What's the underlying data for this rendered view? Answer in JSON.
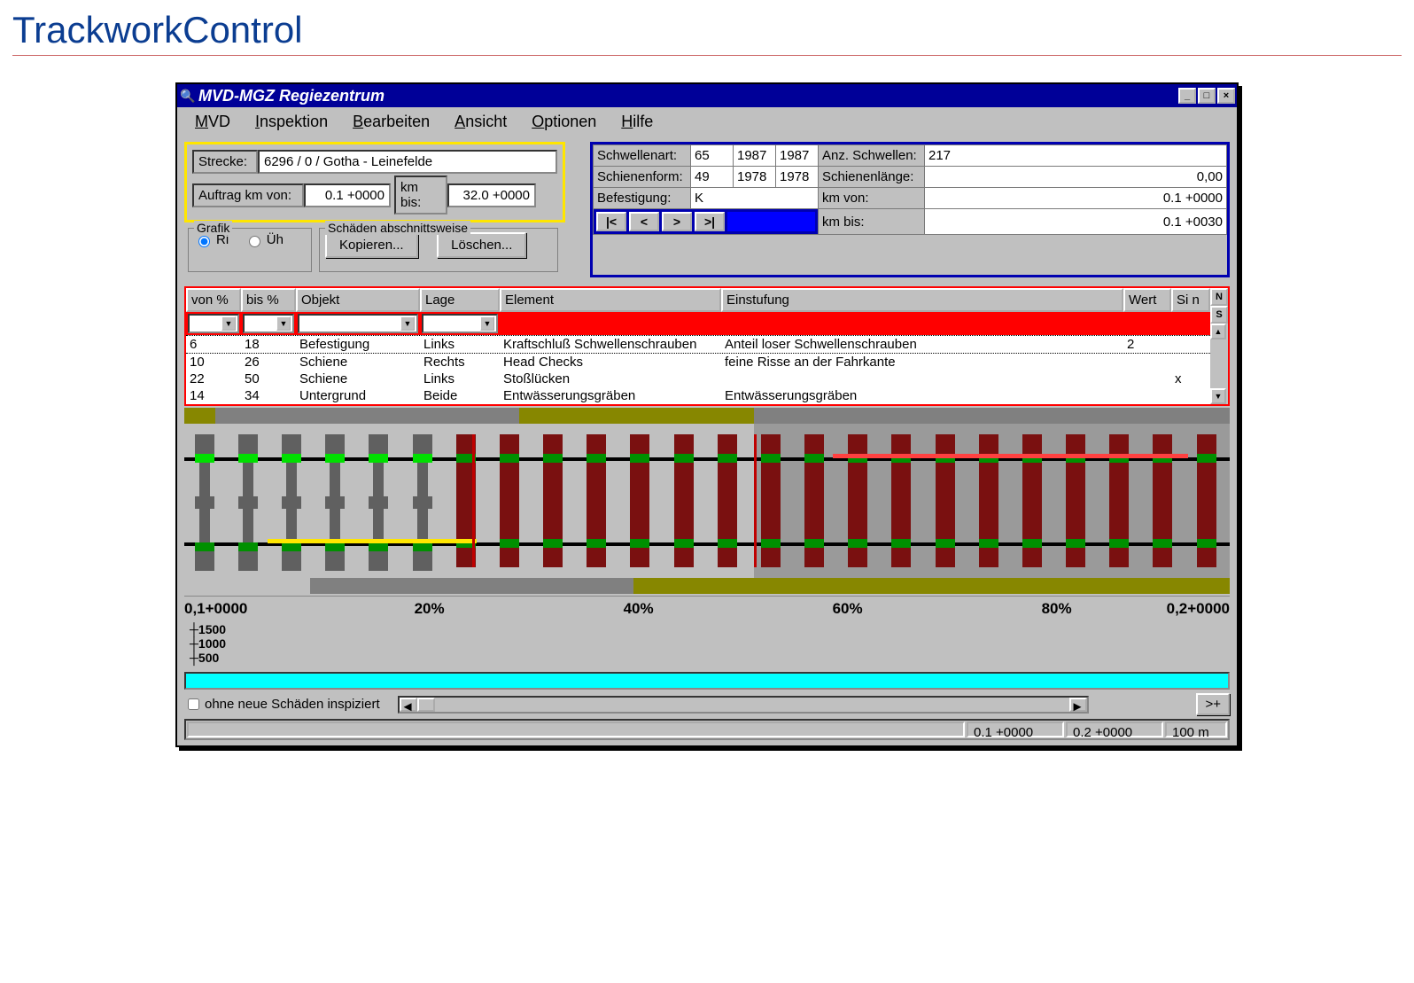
{
  "page_title": "TrackworkControl",
  "window": {
    "title": "MVD-MGZ Regiezentrum",
    "menu": [
      "MVD",
      "Inspektion",
      "Bearbeiten",
      "Ansicht",
      "Optionen",
      "Hilfe"
    ],
    "controls": {
      "min": "_",
      "max": "□",
      "close": "×"
    }
  },
  "left_panel": {
    "strecke_label": "Strecke:",
    "strecke_value": "6296 / 0 / Gotha - Leinefelde",
    "auftrag_label": "Auftrag  km von:",
    "km_von": "0.1 +0000",
    "km_bis_label": "km bis:",
    "km_bis": "32.0 +0000",
    "grafik_title": "Grafik",
    "radio_ri": "Ri",
    "radio_uh": "Üh",
    "schaden_title": "Schäden abschnittsweise",
    "btn_kopieren": "Kopieren...",
    "btn_loeschen": "Löschen..."
  },
  "right_panel": {
    "schwellenart_l": "Schwellenart:",
    "schwellenart_v": "65",
    "schw_y1": "1987",
    "schw_y2": "1987",
    "anz_schw_l": "Anz. Schwellen:",
    "anz_schw_v": "217",
    "schienenform_l": "Schienenform:",
    "schienenform_v": "49",
    "sf_y1": "1978",
    "sf_y2": "1978",
    "schienenlaenge_l": "Schienenlänge:",
    "schienenlaenge_v": "0,00",
    "befestigung_l": "Befestigung:",
    "befestigung_v": "K",
    "km_von_l": "km von:",
    "km_von_v": "0.1 +0000",
    "km_bis_l": "km bis:",
    "km_bis_v": "0.1 +0030",
    "nav": {
      "first": "|<",
      "prev": "<",
      "next": ">",
      "last": ">|"
    }
  },
  "table": {
    "headers": [
      "von %",
      "bis %",
      "Objekt",
      "Lage",
      "Element",
      "Einstufung",
      "Wert",
      "Si n"
    ],
    "side_n": "N",
    "side_s": "S",
    "rows": [
      {
        "von": "6",
        "bis": "18",
        "objekt": "Befestigung",
        "lage": "Links",
        "element": "Kraftschluß Schwellenschrauben",
        "einstufung": "Anteil loser Schwellenschrauben",
        "wert": "2",
        "sin": ""
      },
      {
        "von": "10",
        "bis": "26",
        "objekt": "Schiene",
        "lage": "Rechts",
        "element": "Head Checks",
        "einstufung": "feine Risse an der Fahrkante",
        "wert": "",
        "sin": ""
      },
      {
        "von": "22",
        "bis": "50",
        "objekt": "Schiene",
        "lage": "Links",
        "element": "Stoßlücken",
        "einstufung": "",
        "wert": "",
        "sin": "x"
      },
      {
        "von": "14",
        "bis": "34",
        "objekt": "Untergrund",
        "lage": "Beide",
        "element": "Entwässerungsgräben",
        "einstufung": "Entwässerungsgräben",
        "wert": "",
        "sin": ""
      }
    ]
  },
  "ruler": {
    "start": "0,1+0000",
    "p20": "20%",
    "p40": "40%",
    "p60": "60%",
    "p80": "80%",
    "end": "0,2+0000",
    "sub": [
      "1500",
      "1000",
      "500"
    ]
  },
  "bottom": {
    "checkbox": "ohne neue Schäden inspiziert",
    "zoom_btn": ">+",
    "status": [
      "0.1 +0000",
      "0.2 +0000",
      "100 m"
    ]
  },
  "colors": {
    "olive": "#878700",
    "green": "#00c000",
    "darkgreen": "#007000",
    "darkred": "#8b0000",
    "yellow": "#ffe600",
    "red": "#ff0000",
    "blue": "#0000b0",
    "cyan": "#00ffff"
  }
}
